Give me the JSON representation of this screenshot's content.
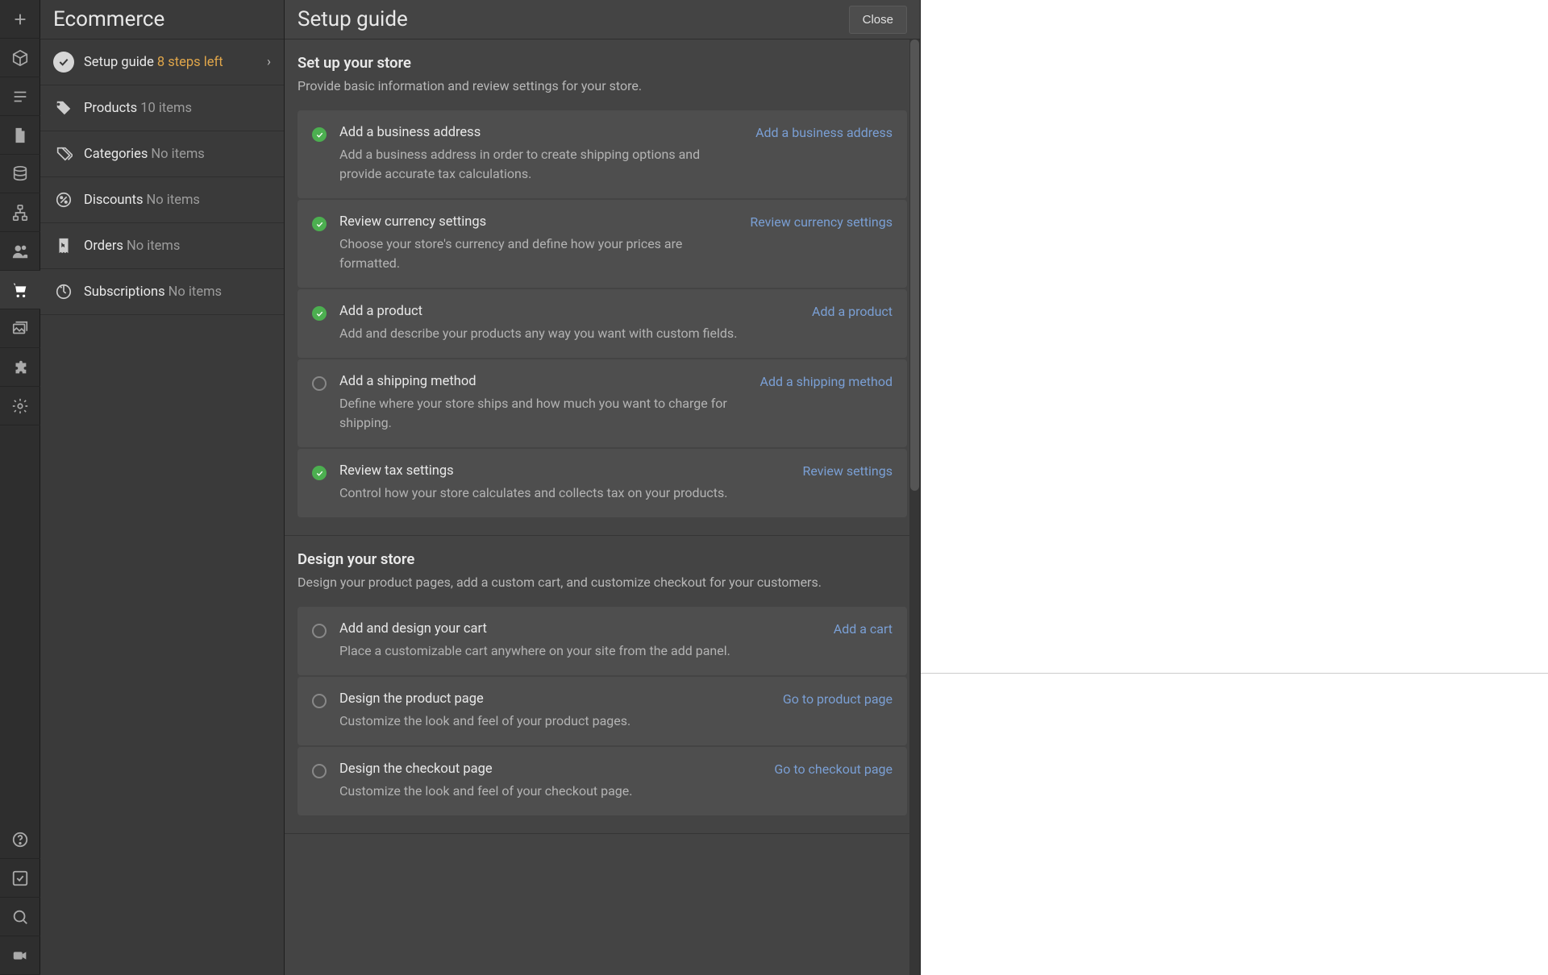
{
  "sidebar": {
    "title": "Ecommerce",
    "items": [
      {
        "label": "Setup guide",
        "sub": "8 steps left",
        "kind": "setup"
      },
      {
        "label": "Products",
        "sub": "10 items"
      },
      {
        "label": "Categories",
        "sub": "No items"
      },
      {
        "label": "Discounts",
        "sub": "No items"
      },
      {
        "label": "Orders",
        "sub": "No items"
      },
      {
        "label": "Subscriptions",
        "sub": "No items"
      }
    ]
  },
  "main": {
    "title": "Setup guide",
    "close": "Close",
    "sections": [
      {
        "title": "Set up your store",
        "desc": "Provide basic information and review settings for your store.",
        "steps": [
          {
            "done": true,
            "name": "Add a business address",
            "action": "Add a business address",
            "sub": "Add a business address in order to create shipping options and provide accurate tax calculations."
          },
          {
            "done": true,
            "name": "Review currency settings",
            "action": "Review currency settings",
            "sub": "Choose your store's currency and define how your prices are formatted."
          },
          {
            "done": true,
            "name": "Add a product",
            "action": "Add a product",
            "sub": "Add and describe your products any way you want with custom fields."
          },
          {
            "done": false,
            "name": "Add a shipping method",
            "action": "Add a shipping method",
            "sub": "Define where your store ships and how much you want to charge for shipping."
          },
          {
            "done": true,
            "name": "Review tax settings",
            "action": "Review settings",
            "sub": "Control how your store calculates and collects tax on your products."
          }
        ]
      },
      {
        "title": "Design your store",
        "desc": "Design your product pages, add a custom cart, and customize checkout for your customers.",
        "steps": [
          {
            "done": false,
            "name": "Add and design your cart",
            "action": "Add a cart",
            "sub": "Place a customizable cart anywhere on your site from the add panel."
          },
          {
            "done": false,
            "name": "Design the product page",
            "action": "Go to product page",
            "sub": "Customize the look and feel of your product pages."
          },
          {
            "done": false,
            "name": "Design the checkout page",
            "action": "Go to checkout page",
            "sub": "Customize the look and feel of your checkout page."
          }
        ]
      }
    ]
  }
}
